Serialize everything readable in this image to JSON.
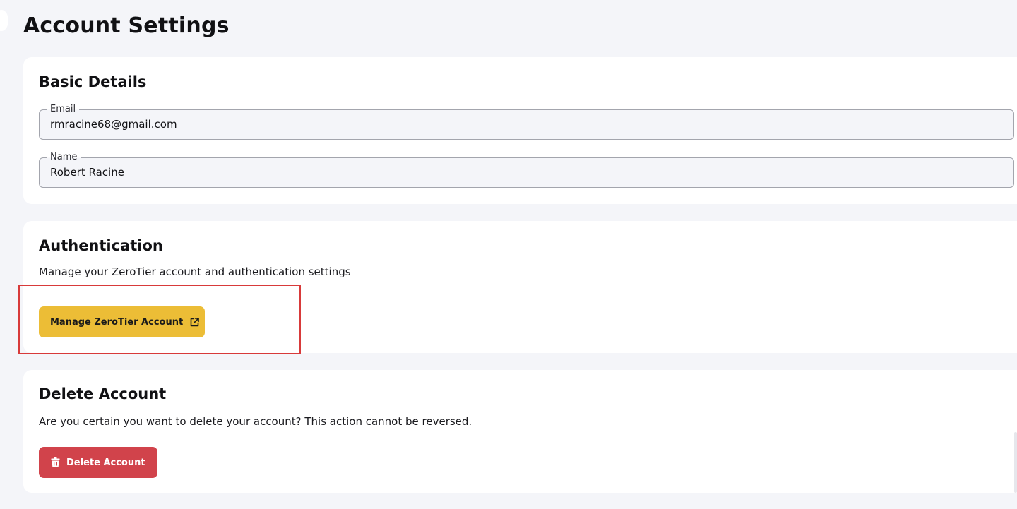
{
  "page": {
    "title": "Account Settings"
  },
  "basic_details": {
    "title": "Basic Details",
    "email": {
      "label": "Email",
      "value": "rmracine68@gmail.com"
    },
    "name": {
      "label": "Name",
      "value": "Robert Racine"
    }
  },
  "authentication": {
    "title": "Authentication",
    "description": "Manage your ZeroTier account and authentication settings",
    "manage_button": {
      "label": "Manage ZeroTier Account",
      "icon": "external-link-icon"
    }
  },
  "delete_account": {
    "title": "Delete Account",
    "description": "Are you certain you want to delete your account? This action cannot be reversed.",
    "delete_button": {
      "label": "Delete Account",
      "icon": "trash-icon"
    }
  },
  "colors": {
    "page_background": "#f4f5f9",
    "card_background": "#ffffff",
    "manage_button": "#ecbd36",
    "delete_button": "#d1434b",
    "highlight_outline": "#d83a3a"
  }
}
